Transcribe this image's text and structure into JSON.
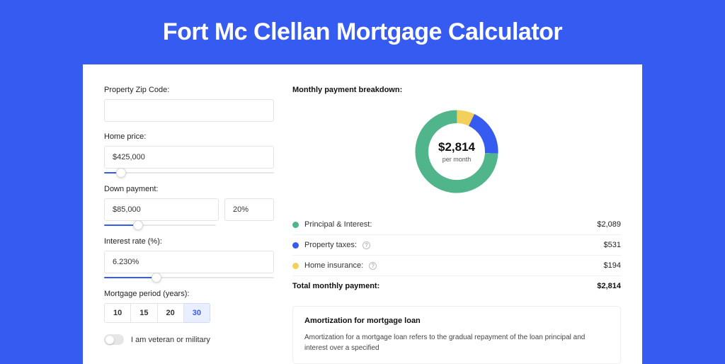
{
  "title": "Fort Mc Clellan Mortgage Calculator",
  "fields": {
    "zip_label": "Property Zip Code:",
    "zip_value": "",
    "home_price_label": "Home price:",
    "home_price_value": "$425,000",
    "down_payment_label": "Down payment:",
    "down_payment_value": "$85,000",
    "down_payment_pct": "20%",
    "interest_rate_label": "Interest rate (%):",
    "interest_rate_value": "6.230%",
    "period_label": "Mortgage period (years):",
    "period_options": [
      "10",
      "15",
      "20",
      "30"
    ],
    "period_selected": "30",
    "veteran_label": "I am veteran or military"
  },
  "breakdown": {
    "heading": "Monthly payment breakdown:",
    "center_amount": "$2,814",
    "center_sub": "per month",
    "rows": {
      "pi_label": "Principal & Interest:",
      "pi_value": "$2,089",
      "tax_label": "Property taxes:",
      "tax_value": "$531",
      "ins_label": "Home insurance:",
      "ins_value": "$194",
      "total_label": "Total monthly payment:",
      "total_value": "$2,814"
    }
  },
  "amort": {
    "heading": "Amortization for mortgage loan",
    "body": "Amortization for a mortgage loan refers to the gradual repayment of the loan principal and interest over a specified"
  },
  "colors": {
    "pi": "#50b58a",
    "tax": "#365bf0",
    "ins": "#f3cf5b"
  },
  "chart_data": {
    "type": "pie",
    "title": "Monthly payment breakdown",
    "series": [
      {
        "name": "Principal & Interest",
        "value": 2089,
        "color": "#50b58a"
      },
      {
        "name": "Property taxes",
        "value": 531,
        "color": "#365bf0"
      },
      {
        "name": "Home insurance",
        "value": 194,
        "color": "#f3cf5b"
      }
    ],
    "total": 2814,
    "unit": "USD per month"
  }
}
